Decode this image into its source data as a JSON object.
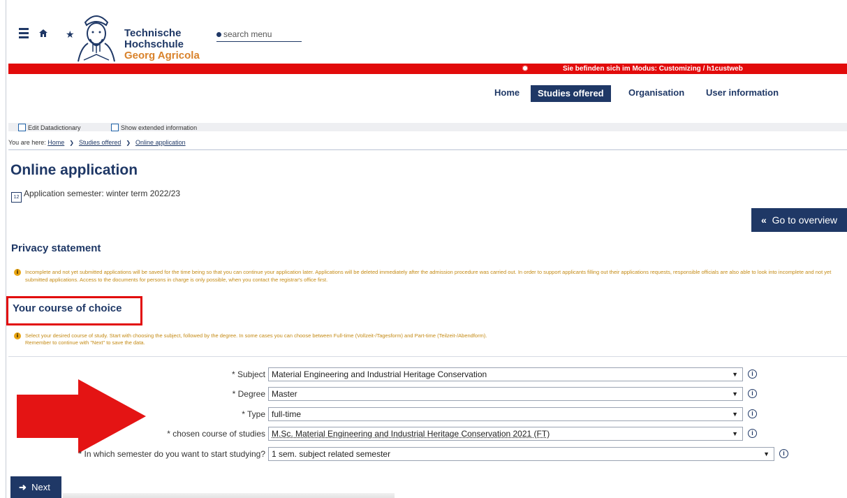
{
  "header": {
    "logo_line1": "Technische",
    "logo_line2": "Hochschule",
    "logo_line3": "Georg Agricola",
    "search_placeholder": "search menu",
    "icons": [
      "menu-icon",
      "home-icon",
      "star-icon",
      "gear-icon"
    ]
  },
  "mode_banner": "Sie befinden sich im Modus: Customizing / h1custweb",
  "nav": [
    "Home",
    "Studies offered",
    "Organisation",
    "User information"
  ],
  "nav_active": "Studies offered",
  "toolbar": {
    "edit_datadictionary": "Edit Datadictionary",
    "show_extended": "Show extended information"
  },
  "breadcrumb": {
    "prefix": "You are here:",
    "items": [
      "Home",
      "Studies offered",
      "Online application"
    ]
  },
  "page_title": "Online application",
  "semester_text": "Application semester: winter term 2022/23",
  "goto_overview": "Go to overview",
  "privacy": {
    "heading": "Privacy statement",
    "text": "Incomplete and not yet submitted applications will be saved for the time being so that you can continue your application later. Applications will be deleted immediately after the admission procedure was carried out. In order to support applicants filling out their applications requests, responsible officials are also able to look into incomplete and not yet submitted applications. Access to the documents for persons in charge is only possible, when you contact the registrar's office first."
  },
  "course": {
    "heading": "Your course of choice",
    "text1": "Select your desired course of study. Start with choosing the subject, followed by the degree. In some cases you can choose between Full-time (Vollzeit-/Tagesform) and Part-time  (Teilzeit-/Abendform).",
    "text2": "Remember to continue with \"Next\" to save the data."
  },
  "fields": {
    "subject": {
      "label": "* Subject",
      "value": "Material Engineering and Industrial Heritage Conservation"
    },
    "degree": {
      "label": "* Degree",
      "value": "Master"
    },
    "type": {
      "label": "* Type",
      "value": "full-time"
    },
    "course": {
      "label": "* chosen course of studies",
      "value": "M.Sc. Material Engineering and Industrial Heritage Conservation 2021 (FT)"
    },
    "semester": {
      "label": "* In which semester do you want to start studying?",
      "value": "1 sem. subject related semester"
    }
  },
  "next_label": "Next",
  "colors": {
    "primary": "#1f3866",
    "banner": "#e20b0b",
    "info_text": "#c48a14",
    "logo_accent": "#d9822b"
  }
}
